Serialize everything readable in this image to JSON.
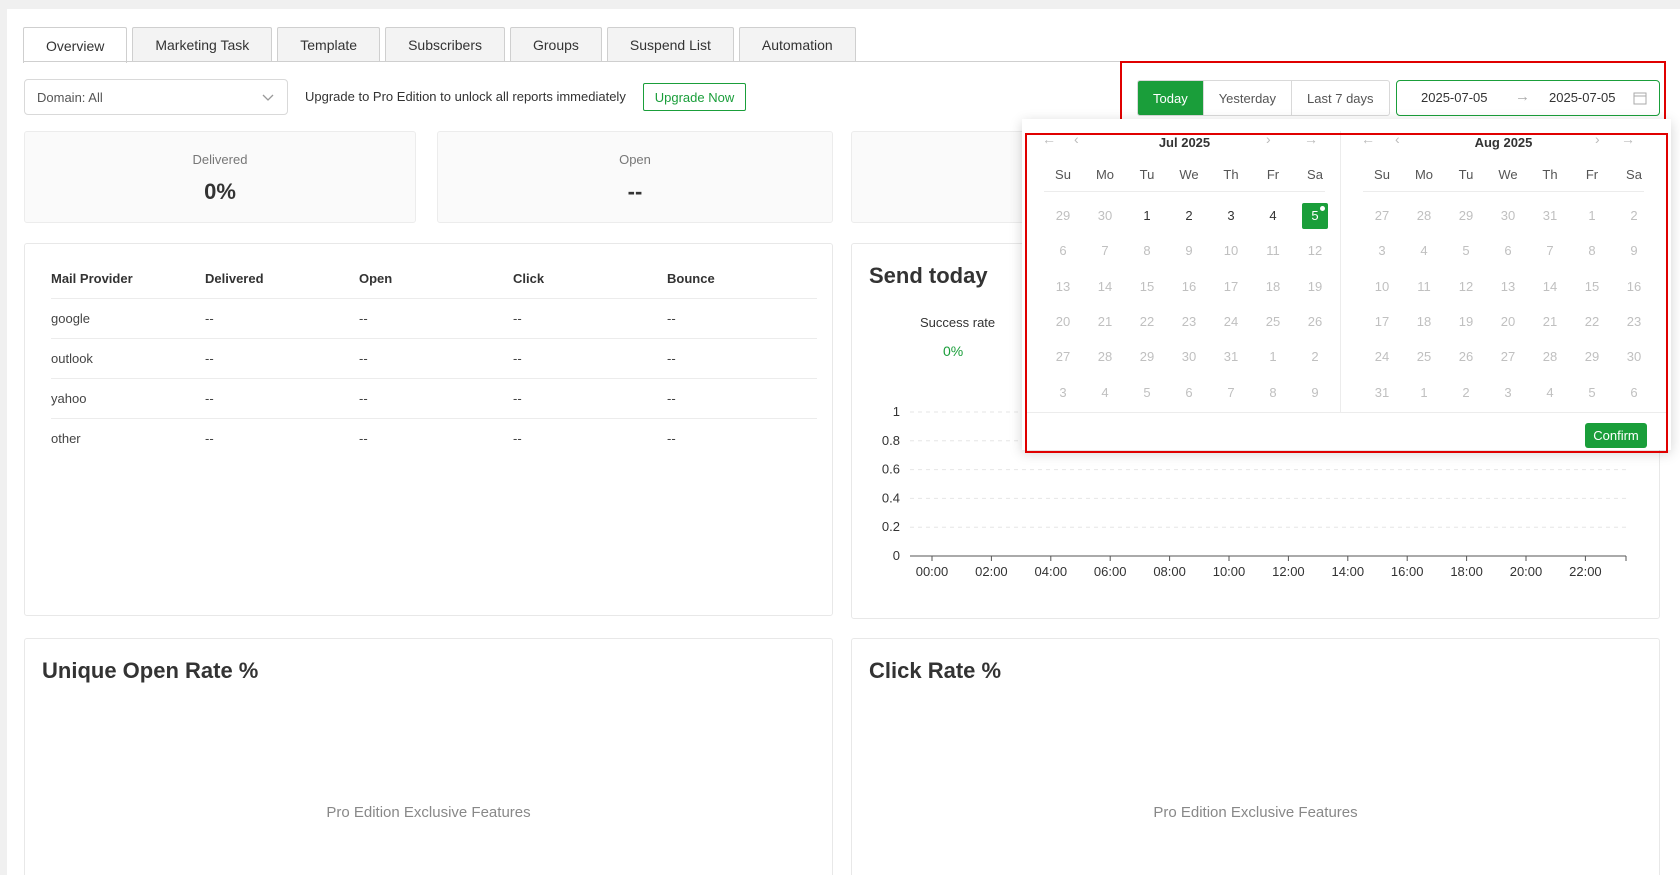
{
  "tabs": [
    {
      "label": "Overview",
      "active": true
    },
    {
      "label": "Marketing Task"
    },
    {
      "label": "Template"
    },
    {
      "label": "Subscribers"
    },
    {
      "label": "Groups"
    },
    {
      "label": "Suspend List"
    },
    {
      "label": "Automation"
    }
  ],
  "filters": {
    "domain_value": "Domain: All",
    "upgrade_text": "Upgrade to Pro Edition to unlock all reports immediately",
    "upgrade_button": "Upgrade Now",
    "quick_ranges": [
      "Today",
      "Yesterday",
      "Last 7 days"
    ],
    "quick_selected": "Today",
    "start_date": "2025-07-05",
    "end_date": "2025-07-05",
    "arrow": "→"
  },
  "stats": [
    {
      "label": "Delivered",
      "value": "0%"
    },
    {
      "label": "Open",
      "value": "--"
    },
    {
      "label": "",
      "value": ""
    }
  ],
  "provider_table": {
    "headers": [
      "Mail Provider",
      "Delivered",
      "Open",
      "Click",
      "Bounce"
    ],
    "rows": [
      [
        "google",
        "--",
        "--",
        "--",
        "--"
      ],
      [
        "outlook",
        "--",
        "--",
        "--",
        "--"
      ],
      [
        "yahoo",
        "--",
        "--",
        "--",
        "--"
      ],
      [
        "other",
        "--",
        "--",
        "--",
        "--"
      ]
    ]
  },
  "send_today": {
    "title": "Send today",
    "success_label": "Success rate",
    "success_value": "0%"
  },
  "chart_data": {
    "type": "line",
    "title": "",
    "xlabel": "",
    "ylabel": "",
    "x": [
      "00:00",
      "02:00",
      "04:00",
      "06:00",
      "08:00",
      "10:00",
      "12:00",
      "14:00",
      "16:00",
      "18:00",
      "20:00",
      "22:00"
    ],
    "y_ticks": [
      "1",
      "0.8",
      "0.6",
      "0.4",
      "0.2",
      "0"
    ],
    "ylim": [
      0,
      1
    ],
    "series": [],
    "grid": true
  },
  "open_rate": {
    "title": "Unique Open Rate %",
    "placeholder": "Pro Edition Exclusive Features"
  },
  "click_rate": {
    "title": "Click Rate %",
    "placeholder": "Pro Edition Exclusive Features"
  },
  "calendar": {
    "weekdays": [
      "Su",
      "Mo",
      "Tu",
      "We",
      "Th",
      "Fr",
      "Sa"
    ],
    "nav": {
      "prev_year": "←",
      "prev_month": "‹",
      "next_month": "›",
      "next_year": "→"
    },
    "months": [
      {
        "title": "Jul 2025",
        "days": [
          [
            "29",
            "off"
          ],
          [
            "30",
            "off"
          ],
          [
            "1",
            "in"
          ],
          [
            "2",
            "in"
          ],
          [
            "3",
            "in"
          ],
          [
            "4",
            "in"
          ],
          [
            "5",
            "sel"
          ],
          [
            "6",
            "off"
          ],
          [
            "7",
            "off"
          ],
          [
            "8",
            "off"
          ],
          [
            "9",
            "off"
          ],
          [
            "10",
            "off"
          ],
          [
            "11",
            "off"
          ],
          [
            "12",
            "off"
          ],
          [
            "13",
            "off"
          ],
          [
            "14",
            "off"
          ],
          [
            "15",
            "off"
          ],
          [
            "16",
            "off"
          ],
          [
            "17",
            "off"
          ],
          [
            "18",
            "off"
          ],
          [
            "19",
            "off"
          ],
          [
            "20",
            "off"
          ],
          [
            "21",
            "off"
          ],
          [
            "22",
            "off"
          ],
          [
            "23",
            "off"
          ],
          [
            "24",
            "off"
          ],
          [
            "25",
            "off"
          ],
          [
            "26",
            "off"
          ],
          [
            "27",
            "off"
          ],
          [
            "28",
            "off"
          ],
          [
            "29",
            "off"
          ],
          [
            "30",
            "off"
          ],
          [
            "31",
            "off"
          ],
          [
            "1",
            "off"
          ],
          [
            "2",
            "off"
          ],
          [
            "3",
            "off"
          ],
          [
            "4",
            "off"
          ],
          [
            "5",
            "off"
          ],
          [
            "6",
            "off"
          ],
          [
            "7",
            "off"
          ],
          [
            "8",
            "off"
          ],
          [
            "9",
            "off"
          ]
        ]
      },
      {
        "title": "Aug 2025",
        "days": [
          [
            "27",
            "off"
          ],
          [
            "28",
            "off"
          ],
          [
            "29",
            "off"
          ],
          [
            "30",
            "off"
          ],
          [
            "31",
            "off"
          ],
          [
            "1",
            "off"
          ],
          [
            "2",
            "off"
          ],
          [
            "3",
            "off"
          ],
          [
            "4",
            "off"
          ],
          [
            "5",
            "off"
          ],
          [
            "6",
            "off"
          ],
          [
            "7",
            "off"
          ],
          [
            "8",
            "off"
          ],
          [
            "9",
            "off"
          ],
          [
            "10",
            "off"
          ],
          [
            "11",
            "off"
          ],
          [
            "12",
            "off"
          ],
          [
            "13",
            "off"
          ],
          [
            "14",
            "off"
          ],
          [
            "15",
            "off"
          ],
          [
            "16",
            "off"
          ],
          [
            "17",
            "off"
          ],
          [
            "18",
            "off"
          ],
          [
            "19",
            "off"
          ],
          [
            "20",
            "off"
          ],
          [
            "21",
            "off"
          ],
          [
            "22",
            "off"
          ],
          [
            "23",
            "off"
          ],
          [
            "24",
            "off"
          ],
          [
            "25",
            "off"
          ],
          [
            "26",
            "off"
          ],
          [
            "27",
            "off"
          ],
          [
            "28",
            "off"
          ],
          [
            "29",
            "off"
          ],
          [
            "30",
            "off"
          ],
          [
            "31",
            "off"
          ],
          [
            "1",
            "off"
          ],
          [
            "2",
            "off"
          ],
          [
            "3",
            "off"
          ],
          [
            "4",
            "off"
          ],
          [
            "5",
            "off"
          ],
          [
            "6",
            "off"
          ]
        ]
      }
    ],
    "confirm_label": "Confirm"
  },
  "colors": {
    "accent": "#1a9e3a",
    "highlight": "#e00000"
  }
}
